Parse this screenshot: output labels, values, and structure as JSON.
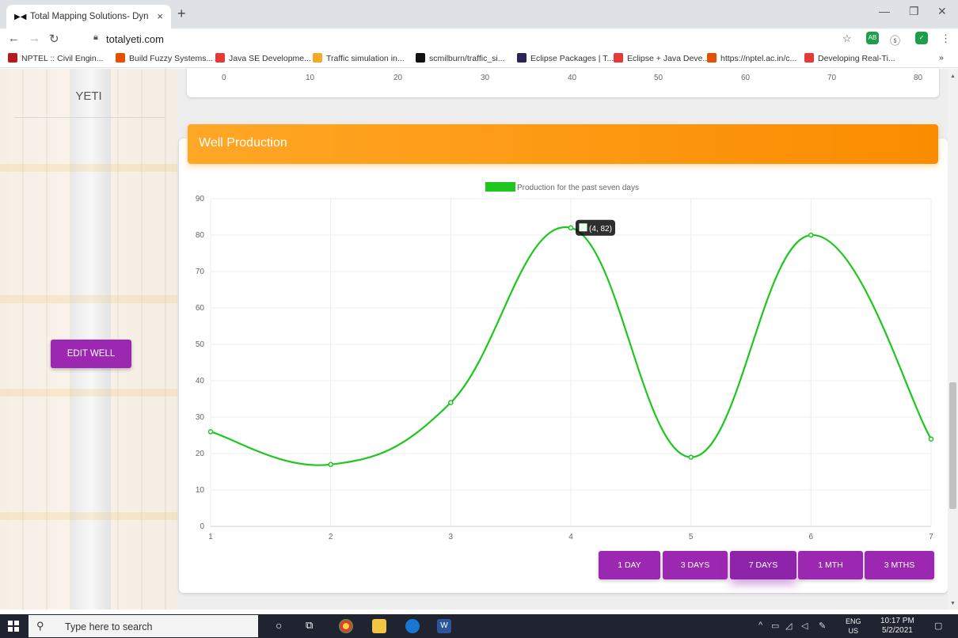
{
  "browser": {
    "tab_title": "Total Mapping Solutions- Dynac",
    "tab_close": "×",
    "new_tab": "+",
    "url": "totalyeti.com",
    "bookmarks": [
      {
        "label": "NPTEL :: Civil Engin...",
        "color": "#b71c1c"
      },
      {
        "label": "Build Fuzzy Systems...",
        "color": "#e65100"
      },
      {
        "label": "Java SE Developme...",
        "color": "#e53935"
      },
      {
        "label": "Traffic simulation in...",
        "color": "#f9a825"
      },
      {
        "label": "scmilburn/traffic_si...",
        "color": "#111111"
      },
      {
        "label": "Eclipse Packages | T...",
        "color": "#2c2255"
      },
      {
        "label": "Eclipse + Java Deve...",
        "color": "#e53935"
      },
      {
        "label": "https://nptel.ac.in/c...",
        "color": "#e65100"
      },
      {
        "label": "Developing Real-Ti...",
        "color": "#e53935"
      }
    ],
    "bookmarks_more": "»"
  },
  "sidebar": {
    "brand": "YETI",
    "edit_button": "EDIT WELL"
  },
  "top_chart_ticks": [
    "0",
    "10",
    "20",
    "30",
    "40",
    "50",
    "60",
    "70",
    "80"
  ],
  "panel": {
    "title": "Well Production"
  },
  "chart_data": {
    "type": "line",
    "legend": "Production for the past seven days",
    "series_color": "#1ec71e",
    "x": [
      1,
      2,
      3,
      4,
      5,
      6,
      7
    ],
    "y": [
      26,
      17,
      34,
      82,
      19,
      80,
      24
    ],
    "x_ticks": [
      "1",
      "2",
      "3",
      "4",
      "5",
      "6",
      "7"
    ],
    "y_ticks": [
      "0",
      "10",
      "20",
      "30",
      "40",
      "50",
      "60",
      "70",
      "80",
      "90"
    ],
    "ylim": [
      0,
      90
    ],
    "xlim": [
      1,
      7
    ],
    "grid": true,
    "legend_position": "top-center",
    "tooltip": "(4, 82)"
  },
  "range_buttons": [
    {
      "label": "1 DAY",
      "active": false
    },
    {
      "label": "3 DAYS",
      "active": false
    },
    {
      "label": "7 DAYS",
      "active": true
    },
    {
      "label": "1 MTH",
      "active": false
    },
    {
      "label": "3 MTHS",
      "active": false
    }
  ],
  "taskbar": {
    "search_placeholder": "Type here to search",
    "lang_top": "ENG",
    "lang_bottom": "US",
    "time": "10:17 PM",
    "date": "5/2/2021"
  },
  "colors": {
    "accent_purple": "#9c27b0",
    "header_orange": "#fb8c00"
  }
}
